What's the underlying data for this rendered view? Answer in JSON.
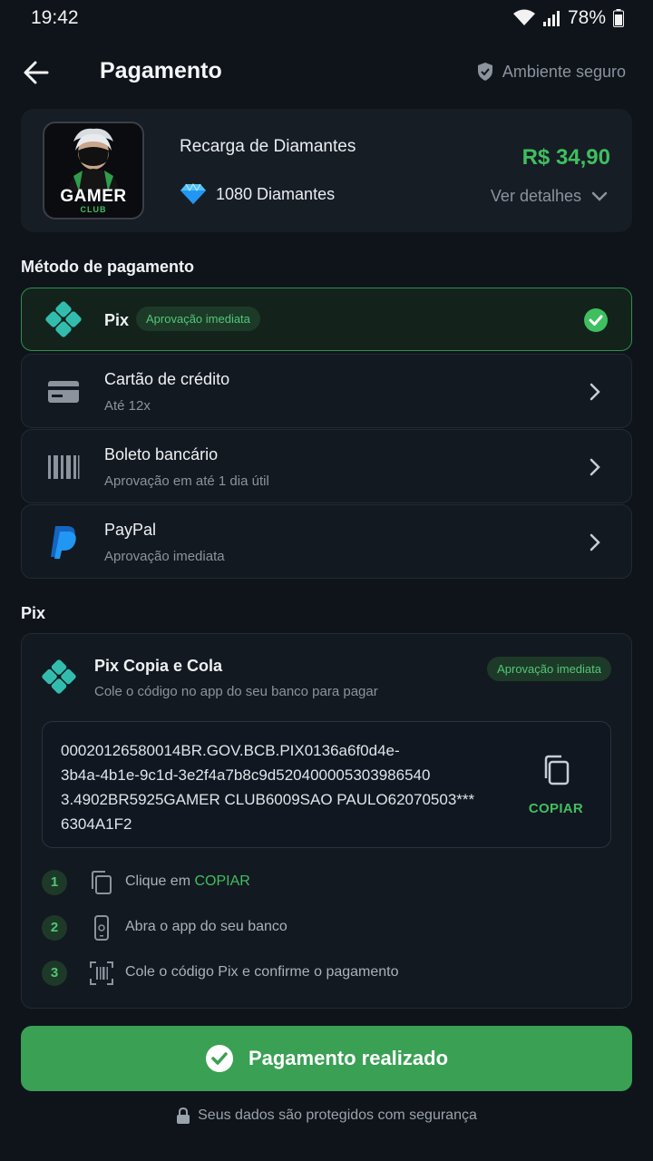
{
  "status_bar": {
    "time": "19:42",
    "battery": "78%"
  },
  "header": {
    "title": "Pagamento",
    "secure_label": "Ambiente seguro"
  },
  "product": {
    "logo_text": "GAMER",
    "logo_sub": "CLUB",
    "name": "Recarga de Diamantes",
    "quantity": "1080 Diamantes",
    "price": "R$ 34,90",
    "details_label": "Ver detalhes"
  },
  "methods_section": {
    "label": "Método de pagamento"
  },
  "methods": [
    {
      "title": "Pix",
      "badge": "Aprovação imediata",
      "selected": true
    },
    {
      "title": "Cartão de crédito",
      "subtitle": "Até 12x"
    },
    {
      "title": "Boleto bancário",
      "subtitle": "Aprovação em até 1 dia útil"
    },
    {
      "title": "PayPal",
      "subtitle": "Aprovação imediata"
    }
  ],
  "pix_section": {
    "label": "Pix"
  },
  "pix": {
    "title": "Pix Copia e Cola",
    "subtitle": "Cole o código no app do seu banco para pagar",
    "badge": "Aprovação imediata",
    "code": "00020126580014BR.GOV.BCB.PIX0136a6f0d4e-3b4a-4b1e-9c1d-3e2f4a7b8c9d5204000053039865403.4902BR5925GAMER CLUB6009SAO PAULO62070503***6304A1F2",
    "code_lines": [
      "00020126580014BR.GOV.BCB.PIX0136a6f0d4e-",
      "3b4a-4b1e-9c1d-3e2f4a7b8c9d520400005303986540",
      "3.4902BR5925GAMER CLUB6009SAO PAULO62070503***",
      "6304A1F2"
    ],
    "copy_label": "COPIAR",
    "steps": [
      {
        "num": "1",
        "text": "Clique em",
        "highlight": "COPIAR"
      },
      {
        "num": "2",
        "text": "Abra o app do seu banco"
      },
      {
        "num": "3",
        "text": "Cole o código Pix e confirme o pagamento"
      }
    ]
  },
  "pay_button": {
    "label": "Pagamento realizado"
  },
  "footer": {
    "text": "Seus dados são protegidos com segurança"
  },
  "colors": {
    "accent": "#3fbf5f",
    "background": "#0f141b",
    "card": "#171d25",
    "button": "#3aa054"
  }
}
